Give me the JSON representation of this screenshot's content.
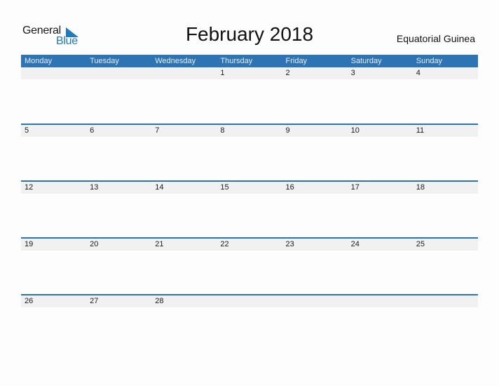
{
  "logo": {
    "line1": "General",
    "line2": "Blue"
  },
  "title": "February 2018",
  "country": "Equatorial Guinea",
  "colors": {
    "accent": "#2e73b4",
    "date_strip": "#f1f1f1",
    "logo_blue": "#1f7bc1"
  },
  "weekdays": [
    "Monday",
    "Tuesday",
    "Wednesday",
    "Thursday",
    "Friday",
    "Saturday",
    "Sunday"
  ],
  "weeks": [
    [
      "",
      "",
      "",
      "1",
      "2",
      "3",
      "4"
    ],
    [
      "5",
      "6",
      "7",
      "8",
      "9",
      "10",
      "11"
    ],
    [
      "12",
      "13",
      "14",
      "15",
      "16",
      "17",
      "18"
    ],
    [
      "19",
      "20",
      "21",
      "22",
      "23",
      "24",
      "25"
    ],
    [
      "26",
      "27",
      "28",
      "",
      "",
      "",
      ""
    ]
  ]
}
